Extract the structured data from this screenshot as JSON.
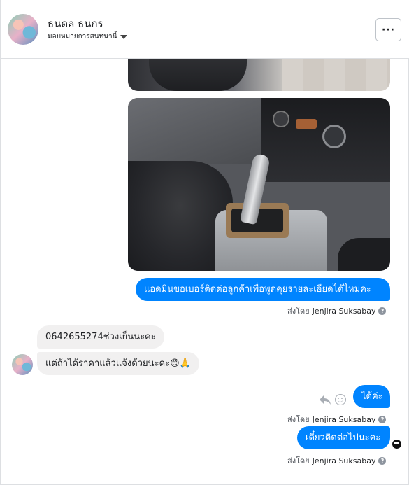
{
  "header": {
    "contact_name": "ธนดล ธนกร",
    "subtitle": "มอบหมายการสนทนานี้",
    "more_label": "···"
  },
  "messages": [
    {
      "direction": "out",
      "text": "แอดมินขอเบอร์ติดต่อลูกค้าเพื่อพูดคุยรายละเอียดได้ไหมคะ"
    },
    {
      "direction": "in",
      "text": "0642655274ช่วงเย็นนะคะ"
    },
    {
      "direction": "in",
      "text": "แต่ถ้าได้ราคาแล้วแจ้งด้วยนะคะ😊🙏"
    },
    {
      "direction": "out",
      "text": "ได้ค่ะ"
    },
    {
      "direction": "out",
      "text": "เดี๋ยวติดต่อไปนะคะ"
    }
  ],
  "sent_by": {
    "prefix": "ส่งโดย",
    "agent_name": "Jenjira Suksabay",
    "info_glyph": "?"
  },
  "colors": {
    "outgoing_bubble": "#0084ff",
    "incoming_bubble": "#f1f0f0"
  },
  "icons": [
    "caret-down-icon",
    "more-icon",
    "reply-icon",
    "smile-icon",
    "info-icon",
    "seen-icon"
  ]
}
